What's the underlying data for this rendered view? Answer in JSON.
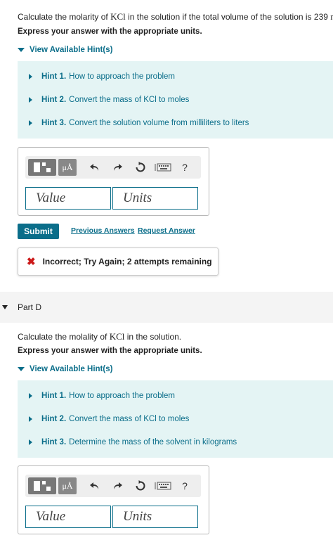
{
  "part_c": {
    "question_prefix": "Calculate the molarity of ",
    "question_compound": "KCl",
    "question_middle": " in the solution if the total volume of the solution is 239 ",
    "question_unit": "mL",
    "question_end": ".",
    "instruction": "Express your answer with the appropriate units.",
    "hint_toggle": "View Available Hint(s)",
    "hints": [
      {
        "num": "Hint 1.",
        "text": "How to approach the problem"
      },
      {
        "num": "Hint 2.",
        "text": "Convert the mass of KCl to moles"
      },
      {
        "num": "Hint 3.",
        "text": "Convert the solution volume from milliliters to liters"
      }
    ],
    "value_placeholder": "Value",
    "units_placeholder": "Units",
    "submit_label": "Submit",
    "previous_answers_label": "Previous Answers",
    "request_answer_label": "Request Answer",
    "feedback_text": "Incorrect; Try Again; 2 attempts remaining"
  },
  "part_d": {
    "title": "Part D",
    "question_prefix": "Calculate the molality of ",
    "question_compound": "KCl",
    "question_end": " in the solution.",
    "instruction": "Express your answer with the appropriate units.",
    "hint_toggle": "View Available Hint(s)",
    "hints": [
      {
        "num": "Hint 1.",
        "text": "How to approach the problem"
      },
      {
        "num": "Hint 2.",
        "text": "Convert the mass of KCl to moles"
      },
      {
        "num": "Hint 3.",
        "text": "Determine the mass of the solvent in kilograms"
      }
    ],
    "value_placeholder": "Value",
    "units_placeholder": "Units"
  },
  "toolbar": {
    "mu_label": "μÅ",
    "help_label": "?"
  },
  "colors": {
    "accent": "#0b6e8a",
    "hint_bg": "#e4f4f4",
    "error": "#cc1a1a"
  }
}
